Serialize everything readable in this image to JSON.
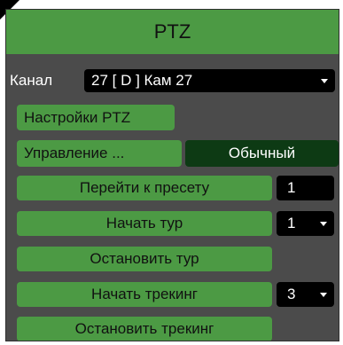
{
  "window": {
    "title": "PTZ"
  },
  "channel": {
    "label": "Канал",
    "value": "27 [ D ] Кам 27"
  },
  "buttons": {
    "ptz_settings": "Настройки PTZ",
    "control": "Управление ...",
    "control_mode": "Обычный",
    "goto_preset": "Перейти к пресету",
    "start_tour": "Начать тур",
    "stop_tour": "Остановить тур",
    "start_tracking": "Начать трекинг",
    "stop_tracking": "Остановить трекинг"
  },
  "values": {
    "preset": "1",
    "tour": "1",
    "tracking": "3"
  },
  "colors": {
    "button_green": "#4c9a44",
    "panel_gray": "#4b4b4b",
    "mode_dark_green": "#0d3a14"
  }
}
